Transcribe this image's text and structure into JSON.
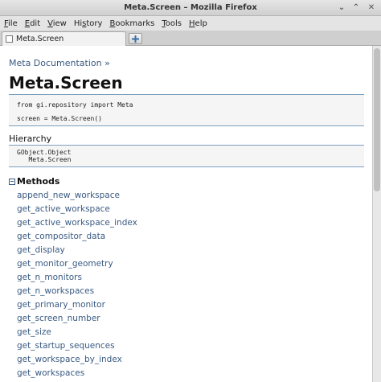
{
  "window": {
    "title": "Meta.Screen – Mozilla Firefox",
    "controls": {
      "minimize": "⌄",
      "maximize": "⌃",
      "close": "✕"
    }
  },
  "menubar": {
    "items": [
      {
        "label": "File",
        "mnemonic": "F",
        "rest": "ile"
      },
      {
        "label": "Edit",
        "mnemonic": "E",
        "rest": "dit"
      },
      {
        "label": "View",
        "mnemonic": "V",
        "rest": "iew"
      },
      {
        "label": "History",
        "pre": "Hi",
        "mnemonic": "s",
        "rest": "tory"
      },
      {
        "label": "Bookmarks",
        "mnemonic": "B",
        "rest": "ookmarks"
      },
      {
        "label": "Tools",
        "mnemonic": "T",
        "rest": "ools"
      },
      {
        "label": "Help",
        "mnemonic": "H",
        "rest": "elp"
      }
    ]
  },
  "tabs": [
    {
      "label": "Meta.Screen",
      "icon": "page-icon",
      "active": true
    }
  ],
  "new_tab_icon": "plus-icon",
  "page": {
    "breadcrumb": "Meta Documentation »",
    "title": "Meta.Screen",
    "code": {
      "import_line": "from gi.repository import Meta",
      "screen_line": "screen = Meta.Screen()"
    },
    "hierarchy": {
      "heading": "Hierarchy",
      "lines": [
        "GObject.Object",
        "   Meta.Screen"
      ]
    },
    "methods": {
      "heading": "Methods",
      "collapse_icon": "collapse-minus-icon",
      "items": [
        "append_new_workspace",
        "get_active_workspace",
        "get_active_workspace_index",
        "get_compositor_data",
        "get_display",
        "get_monitor_geometry",
        "get_n_monitors",
        "get_n_workspaces",
        "get_primary_monitor",
        "get_screen_number",
        "get_size",
        "get_startup_sequences",
        "get_workspace_by_index",
        "get_workspaces"
      ]
    }
  },
  "colors": {
    "link": "#3a5a82",
    "code_border": "#7aa0c0",
    "code_bg": "#f5f5f5"
  }
}
